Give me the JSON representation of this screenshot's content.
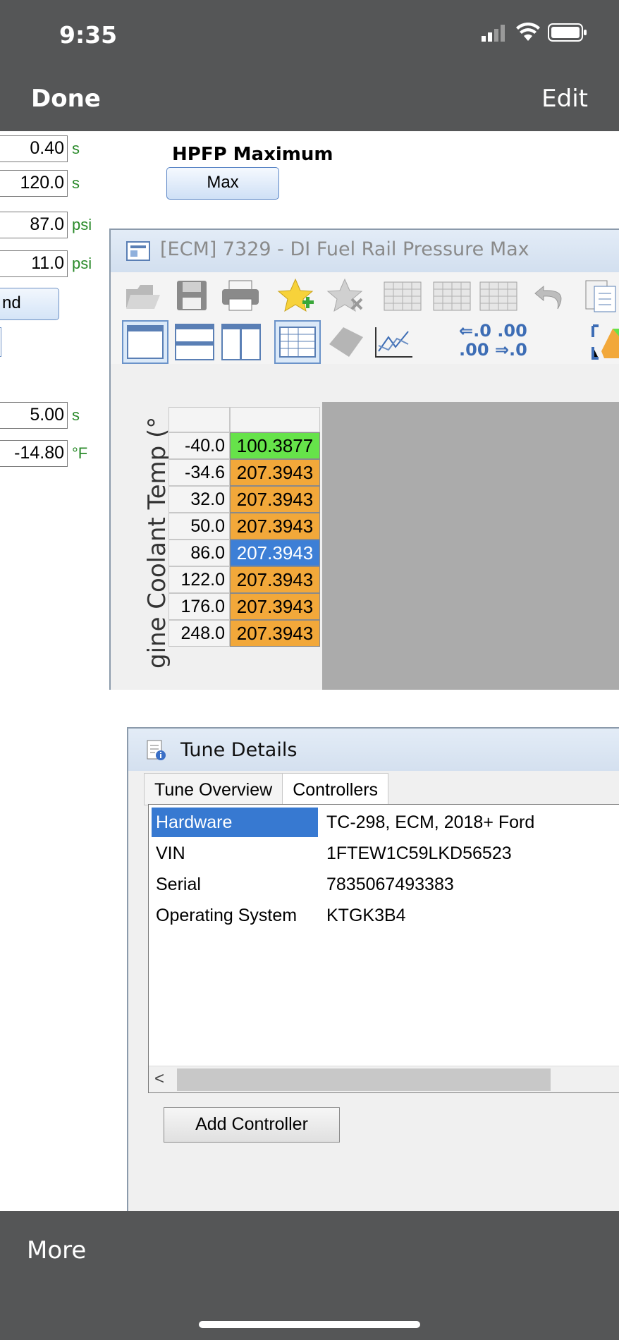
{
  "status": {
    "time": "9:35"
  },
  "nav": {
    "done": "Done",
    "edit": "Edit",
    "more": "More"
  },
  "params": [
    {
      "value": "0.40",
      "unit": "s"
    },
    {
      "value": "120.0",
      "unit": "s"
    },
    {
      "value": "87.0",
      "unit": "psi"
    },
    {
      "value": "11.0",
      "unit": "psi"
    },
    {
      "value": "5.00",
      "unit": "s"
    },
    {
      "value": "-14.80",
      "unit": "°F"
    }
  ],
  "left_button": {
    "label": "nd"
  },
  "hpfp": {
    "label": "HPFP Maximum",
    "button": "Max"
  },
  "ecm": {
    "title": "[ECM] 7329 - DI Fuel Rail Pressure Max",
    "axis_label": "gine Coolant Temp (°",
    "decimal_inc_top": "⇐.0 .00",
    "decimal_inc_bottom": ".00 ⇒.0",
    "rows": [
      {
        "temp": "-40.0",
        "value": "100.3877",
        "color": "#66e34a"
      },
      {
        "temp": "-34.6",
        "value": "207.3943",
        "color": "#f2a83a"
      },
      {
        "temp": "32.0",
        "value": "207.3943",
        "color": "#f2a83a"
      },
      {
        "temp": "50.0",
        "value": "207.3943",
        "color": "#f2a83a"
      },
      {
        "temp": "86.0",
        "value": "207.3943",
        "color": "#3d7fd6"
      },
      {
        "temp": "122.0",
        "value": "207.3943",
        "color": "#f2a83a"
      },
      {
        "temp": "176.0",
        "value": "207.3943",
        "color": "#f2a83a"
      },
      {
        "temp": "248.0",
        "value": "207.3943",
        "color": "#f2a83a"
      }
    ]
  },
  "tune": {
    "title": "Tune Details",
    "tabs": [
      "Tune Overview",
      "Controllers"
    ],
    "rows": [
      {
        "key": "Hardware",
        "value": "TC-298, ECM, 2018+ Ford"
      },
      {
        "key": "VIN",
        "value": "1FTEW1C59LKD56523"
      },
      {
        "key": "Serial",
        "value": "7835067493383"
      },
      {
        "key": "Operating System",
        "value": "KTGK3B4"
      }
    ],
    "scroll_arrow": "<",
    "add_button": "Add Controller"
  }
}
